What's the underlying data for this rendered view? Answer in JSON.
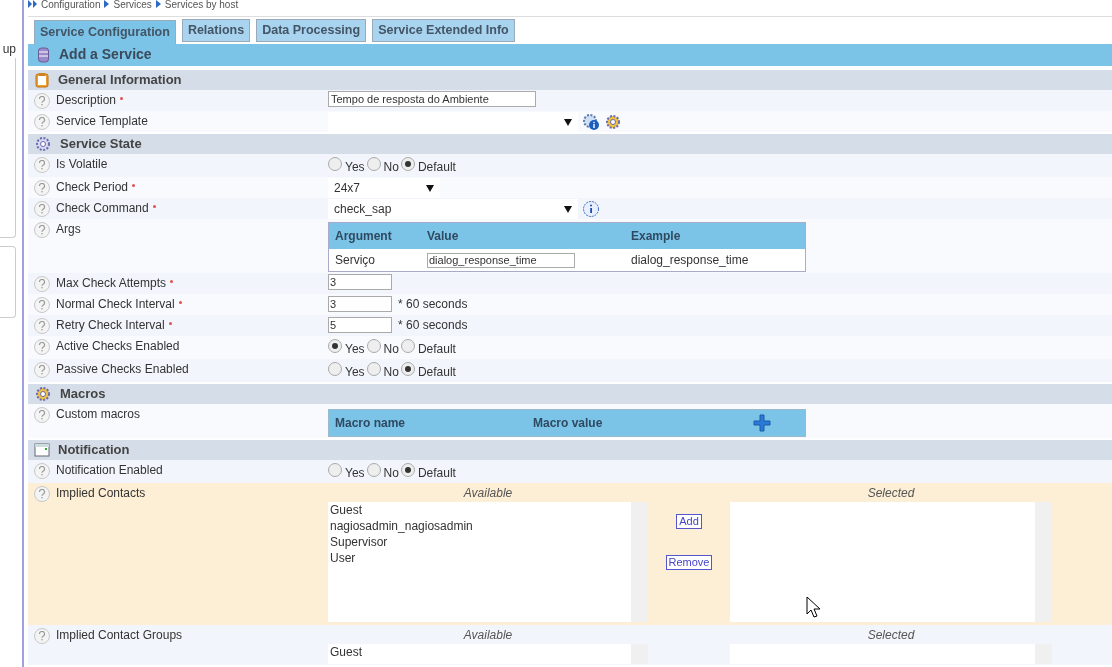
{
  "breadcrumb": [
    "Configuration",
    "Services",
    "Services by host"
  ],
  "sidebar": {
    "partial_text": "up"
  },
  "tabs": [
    {
      "label": "Service Configuration",
      "selected": true
    },
    {
      "label": "Relations",
      "selected": false
    },
    {
      "label": "Data Processing",
      "selected": false
    },
    {
      "label": "Service Extended Info",
      "selected": false
    }
  ],
  "title": "Add a Service",
  "sections": [
    {
      "title": "General Information",
      "rows": [
        {
          "kind": "text",
          "label": "Description",
          "required": true,
          "value": "Tempo de resposta do Ambiente"
        },
        {
          "kind": "select",
          "label": "Service Template",
          "required": false,
          "value": "",
          "wide": true
        }
      ]
    },
    {
      "title": "Service State",
      "rows": [
        {
          "kind": "radio",
          "label": "Is Volatile",
          "required": false,
          "options": [
            {
              "label": "Yes",
              "selected": false
            },
            {
              "label": "No",
              "selected": false
            },
            {
              "label": "Default",
              "selected": true
            }
          ]
        },
        {
          "kind": "select",
          "label": "Check Period",
          "required": true,
          "value": "24x7",
          "wide": false
        },
        {
          "kind": "select",
          "label": "Check Command",
          "required": true,
          "value": "check_sap",
          "wide": true
        },
        {
          "kind": "args",
          "label": "Args",
          "required": false,
          "columns": [
            "Argument",
            "Value",
            "Example"
          ],
          "rows": [
            {
              "argument": "Serviço",
              "value": "dialog_response_time",
              "example": "dialog_response_time"
            }
          ]
        },
        {
          "kind": "number",
          "label": "Max Check Attempts",
          "required": true,
          "value": "3"
        },
        {
          "kind": "number",
          "label": "Normal Check Interval",
          "required": true,
          "value": "3",
          "unit": "* 60 seconds"
        },
        {
          "kind": "number",
          "label": "Retry Check Interval",
          "required": true,
          "value": "5",
          "unit": "* 60 seconds"
        },
        {
          "kind": "radio",
          "label": "Active Checks Enabled",
          "required": false,
          "options": [
            {
              "label": "Yes",
              "selected": true
            },
            {
              "label": "No",
              "selected": false
            },
            {
              "label": "Default",
              "selected": false
            }
          ]
        },
        {
          "kind": "radio",
          "label": "Passive Checks Enabled",
          "required": false,
          "options": [
            {
              "label": "Yes",
              "selected": false
            },
            {
              "label": "No",
              "selected": false
            },
            {
              "label": "Default",
              "selected": true
            }
          ]
        }
      ]
    },
    {
      "title": "Macros",
      "rows": [
        {
          "kind": "macros",
          "label": "Custom macros",
          "required": false,
          "columns": [
            "Macro name",
            "Macro value"
          ]
        }
      ]
    },
    {
      "title": "Notification",
      "rows": [
        {
          "kind": "radio",
          "label": "Notification Enabled",
          "required": false,
          "options": [
            {
              "label": "Yes",
              "selected": false
            },
            {
              "label": "No",
              "selected": false
            },
            {
              "label": "Default",
              "selected": true
            }
          ]
        },
        {
          "kind": "duallist",
          "label": "Implied Contacts",
          "required": false,
          "highlighted": true,
          "available_title": "Available",
          "selected_title": "Selected",
          "available": [
            "Guest",
            "nagiosadmin_nagiosadmin",
            "Supervisor",
            "User"
          ],
          "selected": [],
          "add": "Add",
          "remove": "Remove",
          "full": true
        },
        {
          "kind": "duallist",
          "label": "Implied Contact Groups",
          "required": false,
          "highlighted": false,
          "available_title": "Available",
          "selected_title": "Selected",
          "available": [
            "Guest"
          ],
          "selected": [],
          "full": false
        }
      ]
    }
  ]
}
